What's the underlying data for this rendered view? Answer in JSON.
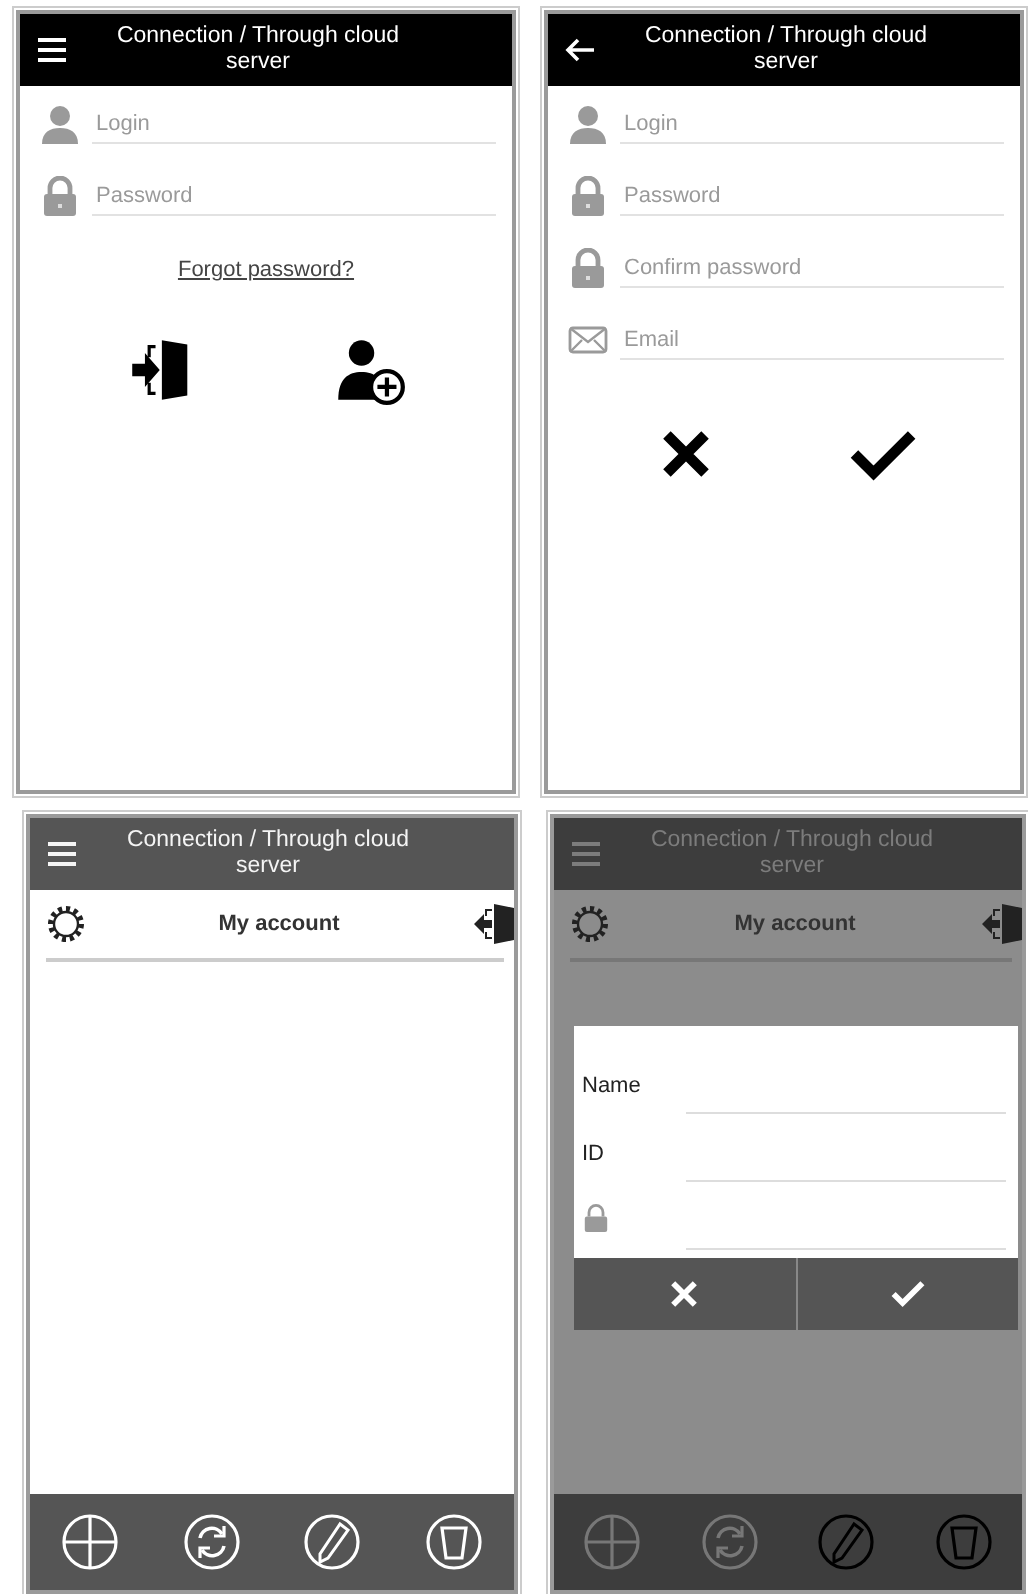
{
  "screens": [
    {
      "kind": "login",
      "header": {
        "kind": "menu",
        "title": "Connection / Through cloud server"
      },
      "fields": [
        {
          "kind": "person",
          "placeholder": "Login"
        },
        {
          "kind": "lock",
          "placeholder": "Password"
        }
      ],
      "link": "Forgot password?",
      "actions": [
        {
          "kind": "sign-in"
        },
        {
          "kind": "add-user"
        }
      ]
    },
    {
      "kind": "login",
      "header": {
        "kind": "back",
        "title": "Connection / Through cloud server"
      },
      "fields": [
        {
          "kind": "person",
          "placeholder": "Login"
        },
        {
          "kind": "lock",
          "placeholder": "Password"
        },
        {
          "kind": "lock",
          "placeholder": "Confirm password"
        },
        {
          "kind": "mail",
          "placeholder": "Email"
        }
      ],
      "actions": [
        {
          "kind": "cancel"
        },
        {
          "kind": "confirm"
        }
      ]
    },
    {
      "kind": "account",
      "dimmed": false,
      "header": {
        "kind": "menu",
        "title": "Connection / Through cloud server"
      },
      "subtitle": "My account"
    },
    {
      "kind": "account",
      "dimmed": true,
      "header": {
        "kind": "menu",
        "title": "Connection / Through cloud server"
      },
      "subtitle": "My account",
      "dialog": {
        "fields": [
          {
            "kind": "text",
            "label": "Name"
          },
          {
            "kind": "text",
            "label": "ID"
          },
          {
            "kind": "lock"
          }
        ]
      }
    }
  ]
}
